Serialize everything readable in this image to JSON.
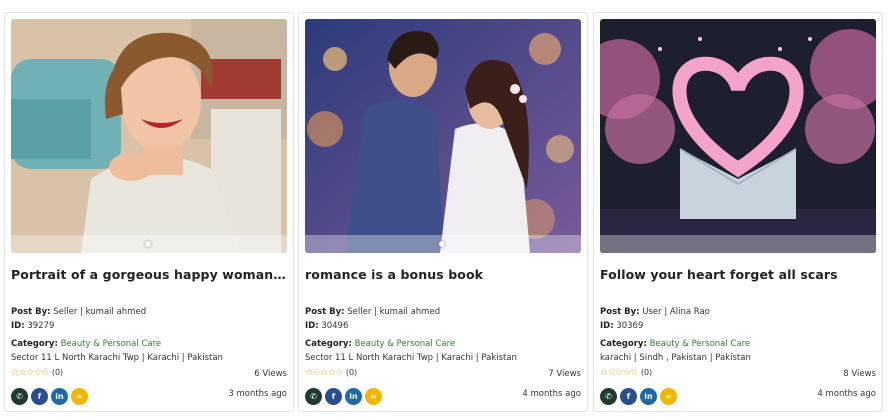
{
  "colors": {
    "category": "#2e7d32",
    "star": "#e0a020",
    "whatsapp": "#1f3b2c",
    "facebook": "#2a4d8f",
    "linkedin": "#1e6aa6",
    "link": "#f2b500"
  },
  "labels": {
    "post_by": "Post By:",
    "id": "ID:",
    "category": "Category:"
  },
  "share_icons": [
    "whatsapp-icon",
    "facebook-icon",
    "linkedin-icon",
    "link-icon"
  ],
  "cards": [
    {
      "title": "Portrait of a gorgeous happy woman by ...",
      "post_by": "Seller | kumail ahmed",
      "id": "39279",
      "category": "Beauty & Personal Care",
      "location": "Sector 11 L North Karachi Twp | Karachi | Pakistan",
      "stars": "☆☆☆☆☆",
      "rating_count": "(0)",
      "views": "6 Views",
      "time_ago": "3 months ago",
      "image": "vintage-woman-photo"
    },
    {
      "title": "romance is a bonus book",
      "post_by": "Seller | kumail ahmed",
      "id": "30496",
      "category": "Beauty & Personal Care",
      "location": "Sector 11 L North Karachi Twp | Karachi | Pakistan",
      "stars": "☆☆☆☆☆",
      "rating_count": "(0)",
      "views": "7 Views",
      "time_ago": "4 months ago",
      "image": "romantic-couple-photo"
    },
    {
      "title": "Follow your heart forget all scars",
      "post_by": "User | Alina Rao",
      "id": "30369",
      "category": "Beauty & Personal Care",
      "location": "karachi | Sindh , Pakistan | Pakistan",
      "stars": "☆☆☆☆☆",
      "rating_count": "(0)",
      "views": "8 Views",
      "time_ago": "4 months ago",
      "image": "heart-envelope-photo"
    }
  ]
}
